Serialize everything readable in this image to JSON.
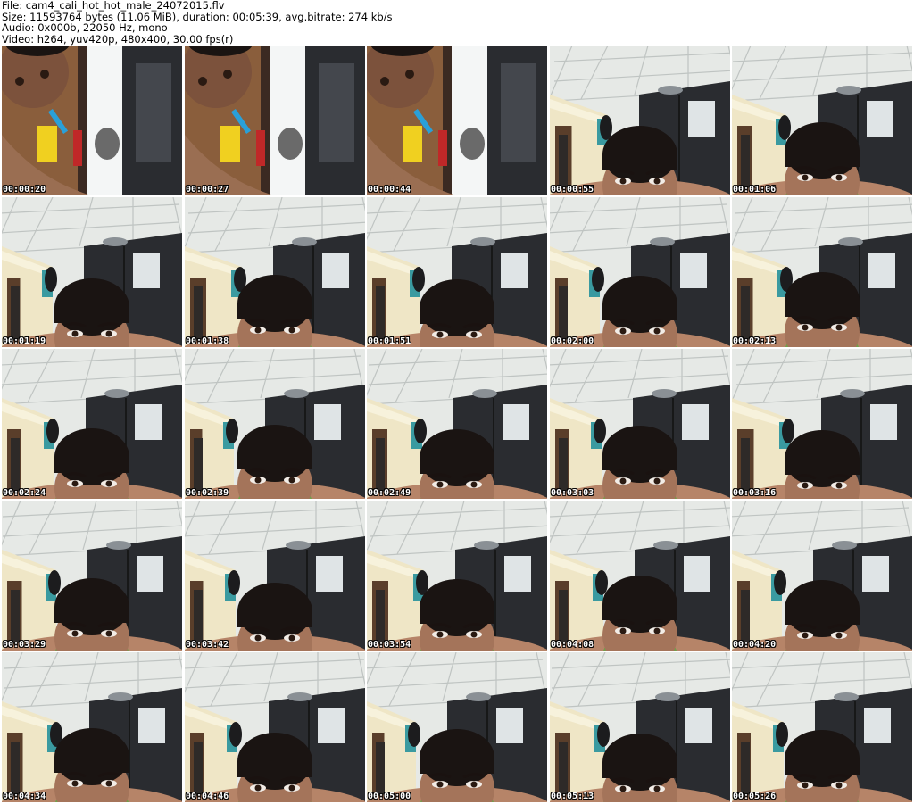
{
  "header": {
    "file_line": "File: cam4_cali_hot_hot_male_24072015.flv",
    "size_line": "Size: 11593764 bytes (11.06 MiB), duration: 00:05:39, avg.bitrate: 274 kb/s",
    "audio_line": "Audio: 0x000b, 22050 Hz, mono",
    "video_line": "Video: h264, yuv420p, 480x400, 30.00 fps(r)"
  },
  "thumbnails": [
    {
      "timestamp": "00:00:20",
      "scene": "closeup"
    },
    {
      "timestamp": "00:00:27",
      "scene": "closeup"
    },
    {
      "timestamp": "00:00:44",
      "scene": "closeup"
    },
    {
      "timestamp": "00:00:55",
      "scene": "ceiling"
    },
    {
      "timestamp": "00:01:06",
      "scene": "ceiling"
    },
    {
      "timestamp": "00:01:19",
      "scene": "ceiling"
    },
    {
      "timestamp": "00:01:38",
      "scene": "ceiling"
    },
    {
      "timestamp": "00:01:51",
      "scene": "ceiling"
    },
    {
      "timestamp": "00:02:00",
      "scene": "ceiling"
    },
    {
      "timestamp": "00:02:13",
      "scene": "ceiling"
    },
    {
      "timestamp": "00:02:24",
      "scene": "ceiling"
    },
    {
      "timestamp": "00:02:39",
      "scene": "ceiling"
    },
    {
      "timestamp": "00:02:49",
      "scene": "ceiling"
    },
    {
      "timestamp": "00:03:03",
      "scene": "ceiling"
    },
    {
      "timestamp": "00:03:16",
      "scene": "ceiling"
    },
    {
      "timestamp": "00:03:29",
      "scene": "ceiling"
    },
    {
      "timestamp": "00:03:42",
      "scene": "ceiling"
    },
    {
      "timestamp": "00:03:54",
      "scene": "ceiling"
    },
    {
      "timestamp": "00:04:08",
      "scene": "ceiling"
    },
    {
      "timestamp": "00:04:20",
      "scene": "ceiling"
    },
    {
      "timestamp": "00:04:34",
      "scene": "ceiling"
    },
    {
      "timestamp": "00:04:46",
      "scene": "ceiling"
    },
    {
      "timestamp": "00:05:00",
      "scene": "ceiling"
    },
    {
      "timestamp": "00:05:13",
      "scene": "ceiling"
    },
    {
      "timestamp": "00:05:26",
      "scene": "ceiling"
    }
  ],
  "colors": {
    "background": "#ffffff",
    "timestamp_text": "#ffffff",
    "timestamp_outline": "#000000",
    "ceiling": "#e6e9e6",
    "wall": "#efe6c6",
    "wardrobe": "#2a2c30",
    "hair": "#1a1412",
    "skin": "#a4745a",
    "shirt": "#6fa04a",
    "towel": "#3a9aa0"
  }
}
